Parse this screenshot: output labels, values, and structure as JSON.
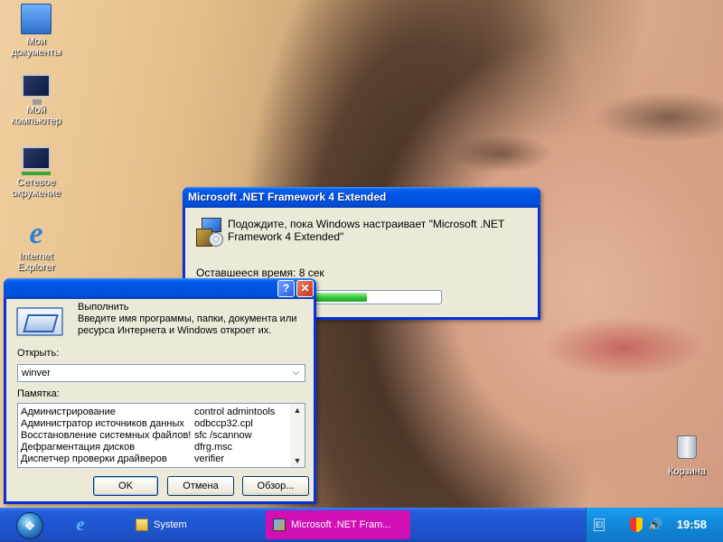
{
  "desktop": {
    "icons": [
      {
        "label": "Мои документы",
        "icon": "my-documents-icon"
      },
      {
        "label": "Мой компьютер",
        "icon": "my-computer-icon"
      },
      {
        "label": "Сетевое окружение",
        "icon": "network-places-icon"
      },
      {
        "label": "Internet Explorer",
        "icon": "internet-explorer-icon"
      },
      {
        "label": "Корзина",
        "icon": "recycle-bin-icon"
      }
    ]
  },
  "net_dialog": {
    "title": "Microsoft .NET Framework 4 Extended",
    "message": "Подождите, пока Windows настраивает \"Microsoft .NET Framework 4 Extended\"",
    "time_remaining": "Оставшееся время: 8 сек",
    "progress": 0.7
  },
  "run_dialog": {
    "help_glyph": "?",
    "close_glyph": "✕",
    "title": "Выполнить",
    "description": "Введите имя программы, папки, документа или ресурса Интернета и Windows откроет их.",
    "open_label": "Открыть:",
    "open_value": "winver",
    "memo_label": "Памятка:",
    "memo_rows": [
      {
        "name": "Администрирование",
        "command": "control admintools"
      },
      {
        "name": "Администратор источников данных",
        "command": "odbccp32.cpl"
      },
      {
        "name": "Восстановление системных файлов!",
        "command": "sfc /scannow"
      },
      {
        "name": "Дефрагментация дисков",
        "command": "dfrg.msc"
      },
      {
        "name": "Диспетчер проверки драйверов",
        "command": "verifier"
      }
    ],
    "ok_label": "OK",
    "cancel_label": "Отмена",
    "browse_label": "Обзор..."
  },
  "taskbar": {
    "start_glyph": "❖",
    "quicklaunch_ie": "e",
    "tasks": [
      {
        "label": "System",
        "icon": "folder-icon"
      },
      {
        "label": "Microsoft .NET Fram...",
        "icon": "installer-icon",
        "active": true
      }
    ],
    "tray": {
      "language": "El",
      "clock": "19:58"
    }
  },
  "colors": {
    "titlebar": "#0054e3",
    "active_task": "#d10fb4",
    "progress_fill": "#37c837"
  }
}
